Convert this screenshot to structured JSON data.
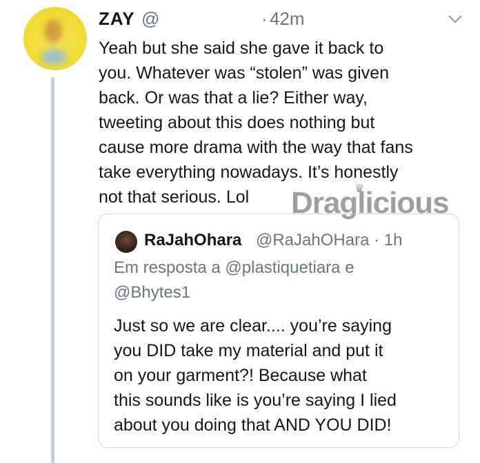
{
  "tweet": {
    "author_name": "ZAY",
    "author_handle": "@",
    "separator": "·",
    "timestamp": "42m",
    "menu_icon": "chevron-down-icon",
    "text": "Yeah but she said she gave it back to\nyou. Whatever was “stolen” was given\nback. Or was that a lie? Either way,\ntweeting about this does nothing but\ncause more drama with the way that fans\ntake everything nowadays. It’s honestly\nnot that serious. Lol"
  },
  "watermark": {
    "text": "Draglicious"
  },
  "quoted_tweet": {
    "author_name": "RaJahOhara",
    "author_handle_time": "@RaJahOHara · 1h",
    "reply_context": "Em resposta a @plastiquetiara e\n@Bhytes1",
    "text": "Just so we are clear.... you’re saying\nyou DID take my material and put it\non your garment?!  Because what\nthis sounds like is you’re saying I lied\nabout you doing that AND YOU DID!"
  },
  "colors": {
    "text": "#14171a",
    "secondary": "#657786",
    "border": "#ccd6dd",
    "thread_line": "#c4ced6"
  }
}
